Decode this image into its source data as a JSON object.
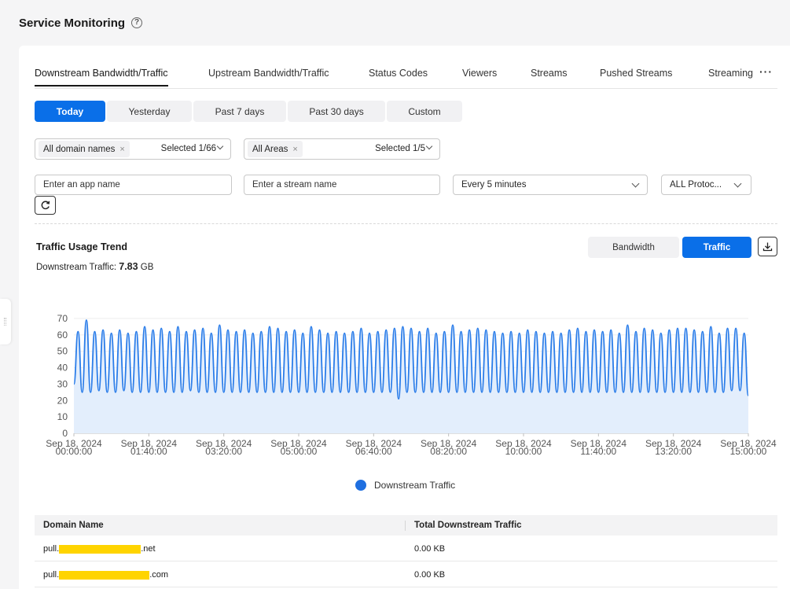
{
  "page": {
    "title": "Service Monitoring",
    "help_icon": "question-circle-icon"
  },
  "tabs": [
    {
      "label": "Downstream Bandwidth/Traffic",
      "active": true
    },
    {
      "label": "Upstream Bandwidth/Traffic",
      "active": false
    },
    {
      "label": "Status Codes",
      "active": false
    },
    {
      "label": "Viewers",
      "active": false
    },
    {
      "label": "Streams",
      "active": false
    },
    {
      "label": "Pushed Streams",
      "active": false
    },
    {
      "label": "Streaming",
      "active": false
    }
  ],
  "tab_more": "···",
  "periods": [
    {
      "label": "Today",
      "active": true
    },
    {
      "label": "Yesterday",
      "active": false
    },
    {
      "label": "Past 7 days",
      "active": false
    },
    {
      "label": "Past 30 days",
      "active": false
    },
    {
      "label": "Custom",
      "active": false
    }
  ],
  "filters": {
    "domain": {
      "chip": "All domain names",
      "chip_close": "×",
      "count": "Selected 1/66"
    },
    "area": {
      "chip": "All Areas",
      "chip_close": "×",
      "count": "Selected 1/5"
    },
    "app_placeholder": "Enter an app name",
    "stream_placeholder": "Enter a stream name",
    "interval": "Every 5 minutes",
    "protocol": "ALL Protoc..."
  },
  "trend": {
    "title": "Traffic Usage Trend",
    "summary_label": "Downstream Traffic:",
    "summary_value": "7.83",
    "summary_unit": "GB",
    "toggle_bandwidth": "Bandwidth",
    "toggle_traffic": "Traffic",
    "active_toggle": "Traffic"
  },
  "chart_data": {
    "type": "line",
    "ylim": [
      0,
      70
    ],
    "yticks": [
      0,
      10,
      20,
      30,
      40,
      50,
      60,
      70
    ],
    "xlim": [
      "Sep 18, 2024 00:00:00",
      "Sep 18, 2024 15:00:00"
    ],
    "x_ticks": [
      {
        "date": "Sep 18, 2024",
        "time": "00:00:00"
      },
      {
        "date": "Sep 18, 2024",
        "time": "01:40:00"
      },
      {
        "date": "Sep 18, 2024",
        "time": "03:20:00"
      },
      {
        "date": "Sep 18, 2024",
        "time": "05:00:00"
      },
      {
        "date": "Sep 18, 2024",
        "time": "06:40:00"
      },
      {
        "date": "Sep 18, 2024",
        "time": "08:20:00"
      },
      {
        "date": "Sep 18, 2024",
        "time": "10:00:00"
      },
      {
        "date": "Sep 18, 2024",
        "time": "11:40:00"
      },
      {
        "date": "Sep 18, 2024",
        "time": "13:20:00"
      },
      {
        "date": "Sep 18, 2024",
        "time": "15:00:00"
      }
    ],
    "series": [
      {
        "name": "Downstream Traffic",
        "color": "#2b7de9",
        "fill": "#e3eefc",
        "peaks": [
          62,
          69,
          62,
          63,
          61,
          63,
          61,
          62,
          65,
          63,
          64,
          62,
          65,
          62,
          63,
          64,
          61,
          66,
          63,
          62,
          63,
          61,
          62,
          65,
          64,
          62,
          63,
          61,
          65,
          63,
          61,
          62,
          61,
          62,
          64,
          61,
          62,
          63,
          64,
          65,
          64,
          62,
          64,
          61,
          62,
          66,
          62,
          63,
          64,
          63,
          62,
          61,
          62,
          61,
          63,
          62,
          61,
          62,
          61,
          63,
          64,
          62,
          63,
          62,
          63,
          61,
          66,
          62,
          64,
          63,
          61,
          63,
          64,
          64,
          63,
          62,
          65,
          61,
          64,
          64,
          61
        ],
        "troughs": [
          30,
          25,
          25,
          26,
          25,
          25,
          26,
          25,
          25,
          25,
          25,
          25,
          25,
          25,
          26,
          25,
          25,
          25,
          25,
          25,
          25,
          25,
          25,
          25,
          25,
          25,
          25,
          25,
          25,
          25,
          25,
          25,
          25,
          25,
          25,
          25,
          25,
          25,
          25,
          21,
          25,
          25,
          25,
          25,
          25,
          25,
          25,
          25,
          25,
          25,
          25,
          25,
          25,
          25,
          25,
          25,
          25,
          25,
          25,
          25,
          25,
          25,
          25,
          25,
          25,
          25,
          25,
          25,
          25,
          25,
          25,
          25,
          25,
          25,
          25,
          25,
          25,
          25,
          25,
          26,
          26,
          23
        ]
      }
    ]
  },
  "table": {
    "columns": [
      "Domain Name",
      "Total Downstream Traffic"
    ],
    "rows": [
      {
        "prefix": "pull.",
        "suffix": ".net",
        "value": "0.00 KB"
      },
      {
        "prefix": "pull.",
        "suffix": ".com",
        "value": "0.00 KB"
      }
    ]
  }
}
